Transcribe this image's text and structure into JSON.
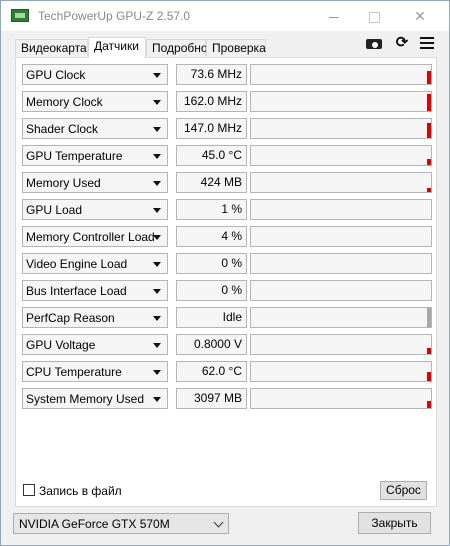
{
  "window": {
    "title": "TechPowerUp GPU-Z 2.57.0",
    "close_glyph": "✕"
  },
  "tabs": [
    {
      "label": "Видеокарта",
      "active": false
    },
    {
      "label": "Датчики",
      "active": true
    },
    {
      "label": "Подробно",
      "active": false
    },
    {
      "label": "Проверка",
      "active": false
    }
  ],
  "toolbar_icons": [
    "camera-icon",
    "refresh-icon",
    "menu-icon"
  ],
  "refresh_glyph": "⟳",
  "sensors": [
    {
      "name": "GPU Clock",
      "value": "73.6 MHz",
      "level": 0.7,
      "color": "#e00000"
    },
    {
      "name": "Memory Clock",
      "value": "162.0 MHz",
      "level": 0.9,
      "color": "#e00000"
    },
    {
      "name": "Shader Clock",
      "value": "147.0 MHz",
      "level": 0.8,
      "color": "#e00000"
    },
    {
      "name": "GPU Temperature",
      "value": "45.0 °C",
      "level": 0.3,
      "color": "#e00000"
    },
    {
      "name": "Memory Used",
      "value": "424 MB",
      "level": 0.2,
      "color": "#e00000"
    },
    {
      "name": "GPU Load",
      "value": "1 %",
      "level": 0,
      "color": "#e00000"
    },
    {
      "name": "Memory Controller Load",
      "value": "4 %",
      "level": 0,
      "color": "#e00000"
    },
    {
      "name": "Video Engine Load",
      "value": "0 %",
      "level": 0,
      "color": "#e00000"
    },
    {
      "name": "Bus Interface Load",
      "value": "0 %",
      "level": 0,
      "color": "#e00000"
    },
    {
      "name": "PerfCap Reason",
      "value": "Idle",
      "level": 1.0,
      "color": "#a8a8a8"
    },
    {
      "name": "GPU Voltage",
      "value": "0.8000 V",
      "level": 0.3,
      "color": "#e00000"
    },
    {
      "name": "CPU Temperature",
      "value": "62.0 °C",
      "level": 0.45,
      "color": "#e00000"
    },
    {
      "name": "System Memory Used",
      "value": "3097 MB",
      "level": 0.35,
      "color": "#e00000"
    }
  ],
  "footer": {
    "log_to_file_label": "Запись в файл",
    "log_to_file_checked": false,
    "reset_label": "Сброс"
  },
  "gpu_select": {
    "selected": "NVIDIA GeForce GTX 570M"
  },
  "close_button_label": "Закрыть"
}
